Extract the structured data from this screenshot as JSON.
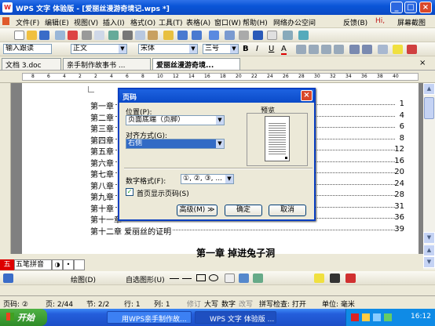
{
  "window": {
    "title": "WPS 文字 体验版 - [爱丽丝漫游奇境记.wps *]",
    "min": "_",
    "max": "□",
    "close": "×"
  },
  "menubar": {
    "items": [
      "文件(F)",
      "编辑(E)",
      "视图(V)",
      "插入(I)",
      "格式(O)",
      "工具(T)",
      "表格(A)",
      "窗口(W)",
      "帮助(H)"
    ],
    "network": "网络办公空间",
    "feedback": "反馈(B)",
    "hi": "Hi,",
    "fullscreen": "屏幕截图"
  },
  "formatbar": {
    "style_label": "输入跟读",
    "style_value": "正文",
    "font": "宋体",
    "size": "三号",
    "bold": "B",
    "italic": "I",
    "underline": "U",
    "fontcolor": "A"
  },
  "tabs": [
    {
      "label": "文档 3.doc"
    },
    {
      "label": "亲手制作故事书 ..."
    },
    {
      "label": "爱丽丝漫游奇境..."
    }
  ],
  "ruler": {
    "marks": [
      "8",
      "6",
      "4",
      "2",
      "2",
      "4",
      "6",
      "8",
      "10",
      "12",
      "14",
      "16",
      "18",
      "20",
      "22",
      "24",
      "26",
      "28",
      "30",
      "32",
      "34",
      "36",
      "38",
      "40"
    ]
  },
  "document": {
    "toc": [
      {
        "label": "第一章",
        "page": "1"
      },
      {
        "label": "第二章",
        "page": "4"
      },
      {
        "label": "第三章",
        "page": "6"
      },
      {
        "label": "第四章",
        "page": "8"
      },
      {
        "label": "第五章",
        "page": "12"
      },
      {
        "label": "第六章",
        "page": "16"
      },
      {
        "label": "第七章",
        "page": "20"
      },
      {
        "label": "第八章",
        "page": "24"
      },
      {
        "label": "第九章",
        "page": "28"
      },
      {
        "label": "第十章",
        "page": "31"
      },
      {
        "label": "第十一章",
        "page": "36"
      },
      {
        "label": "第十二章  爱丽丝的证明",
        "page": "39"
      }
    ],
    "heading": "第一章  掉进兔子洞"
  },
  "dialog": {
    "title": "页码",
    "position_label": "位置(P):",
    "position_value": "页面底端（页脚）",
    "align_label": "对齐方式(G):",
    "align_value": "右侧",
    "preview_label": "预览",
    "format_label": "数字格式(F):",
    "format_value": "①, ②, ③, ...",
    "first_page_label": "首页显示页码(S)",
    "first_page_checked": true,
    "advanced": "高级(M) ≫",
    "ok": "确定",
    "cancel": "取消",
    "close": "×"
  },
  "ime": {
    "label": "五笔拼音"
  },
  "drawbar": {
    "draw": "绘图(D)",
    "autoshape": "自选图形(U)"
  },
  "status": {
    "page": "页码: ②",
    "pages": "页: 2/44",
    "section": "节: 2/2",
    "row": "行: 1",
    "col": "列: 1",
    "mode1": "修订",
    "mode2": "大写",
    "mode3": "数字",
    "mode4": "改写",
    "spell": "拼写检查: 打开",
    "unit": "单位: 毫米"
  },
  "taskbar": {
    "start": "开始",
    "tasks": [
      "用WPS亲手制作故...",
      "WPS 文字 体验版 ..."
    ],
    "time": "16:12"
  }
}
